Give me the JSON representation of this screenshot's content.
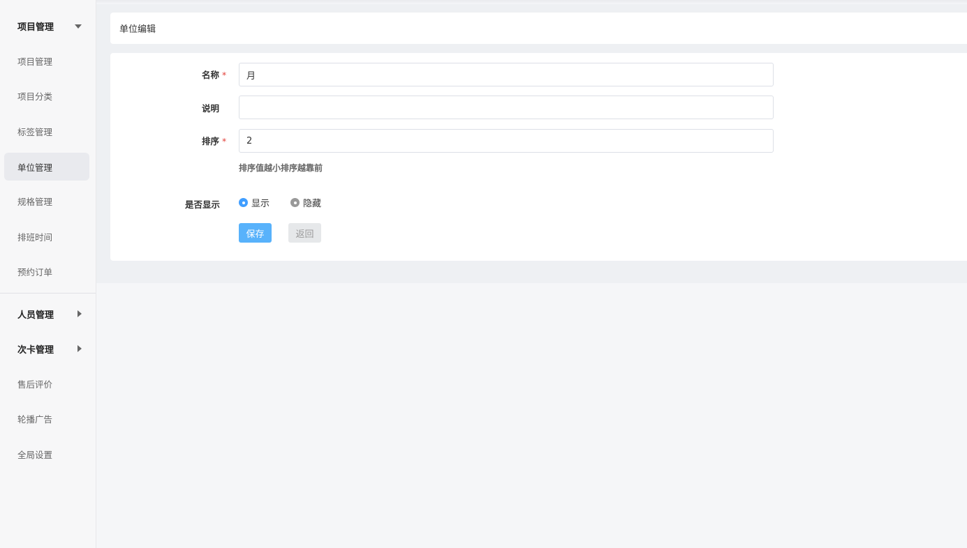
{
  "sidebar": {
    "groups": [
      {
        "label": "项目管理",
        "caret": "chevron-down-icon"
      },
      {
        "label": "人员管理",
        "caret": "chevron-right-icon"
      },
      {
        "label": "次卡管理",
        "caret": "chevron-right-icon"
      }
    ],
    "items": [
      {
        "label": "项目管理"
      },
      {
        "label": "项目分类"
      },
      {
        "label": "标签管理"
      },
      {
        "label": "单位管理",
        "active": true
      },
      {
        "label": "规格管理"
      },
      {
        "label": "排班时间"
      },
      {
        "label": "预约订单"
      },
      {
        "label": "售后评价"
      },
      {
        "label": "轮播广告"
      },
      {
        "label": "全局设置"
      }
    ]
  },
  "page": {
    "title": "单位编辑"
  },
  "form": {
    "name": {
      "label": "名称",
      "required": "*",
      "value": "月"
    },
    "desc": {
      "label": "说明",
      "value": ""
    },
    "sort": {
      "label": "排序",
      "required": "*",
      "value": "2",
      "hint": "排序值越小排序越靠前"
    },
    "visible": {
      "label": "是否显示",
      "options": [
        {
          "label": "显示",
          "checked": true
        },
        {
          "label": "隐藏",
          "checked": false
        }
      ]
    },
    "save_label": "保存",
    "back_label": "返回"
  },
  "colors": {
    "accent": "#409eff",
    "save_button": "#58b2fb",
    "required": "#e2403a"
  }
}
